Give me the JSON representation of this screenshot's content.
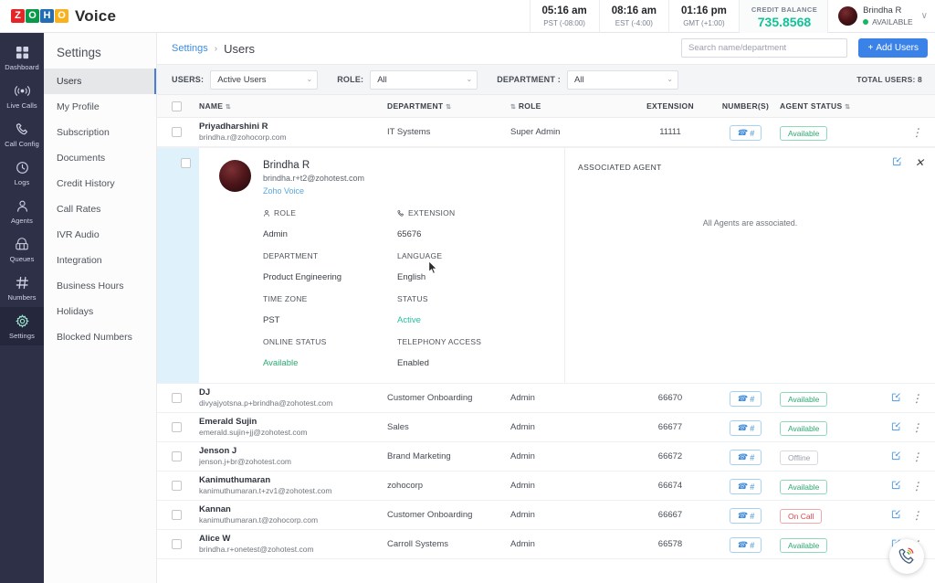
{
  "header": {
    "brand_letters": [
      "Z",
      "O",
      "H",
      "O"
    ],
    "brand_name": "Voice",
    "timezones": [
      {
        "time": "05:16 am",
        "zone": "PST (-08:00)"
      },
      {
        "time": "08:16 am",
        "zone": "EST (-4:00)"
      },
      {
        "time": "01:16 pm",
        "zone": "GMT (+1:00)"
      }
    ],
    "credit_label": "CREDIT BALANCE",
    "credit_value": "735.8568",
    "user_name": "Brindha R",
    "user_status": "AVAILABLE",
    "chevron": "∨"
  },
  "leftnav": {
    "items": [
      {
        "label": "Dashboard",
        "icon": "grid-icon"
      },
      {
        "label": "Live Calls",
        "icon": "broadcast-icon"
      },
      {
        "label": "Call Config",
        "icon": "phone-icon"
      },
      {
        "label": "Logs",
        "icon": "clock-icon"
      },
      {
        "label": "Agents",
        "icon": "person-icon"
      },
      {
        "label": "Queues",
        "icon": "queue-icon"
      },
      {
        "label": "Numbers",
        "icon": "hash-icon"
      },
      {
        "label": "Settings",
        "icon": "gear-icon"
      }
    ],
    "active": "Settings"
  },
  "subnav": {
    "title": "Settings",
    "items": [
      "Users",
      "My Profile",
      "Subscription",
      "Documents",
      "Credit History",
      "Call Rates",
      "IVR Audio",
      "Integration",
      "Business Hours",
      "Holidays",
      "Blocked Numbers"
    ],
    "active": "Users"
  },
  "breadcrumb": {
    "parent": "Settings",
    "separator": "›",
    "current": "Users"
  },
  "search": {
    "placeholder": "Search name/department",
    "value": ""
  },
  "add_button": {
    "plus": "+",
    "label": "Add Users"
  },
  "filters": {
    "users_label": "USERS:",
    "users_value": "Active Users",
    "role_label": "ROLE:",
    "role_value": "All",
    "dept_label": "DEPARTMENT :",
    "dept_value": "All",
    "caret": "⌄",
    "total_users": "TOTAL USERS: 8"
  },
  "table": {
    "columns": {
      "name": "NAME",
      "department": "DEPARTMENT",
      "role": "ROLE",
      "extension": "EXTENSION",
      "numbers": "NUMBER(S)",
      "agent_status": "AGENT STATUS"
    },
    "sort_icon": "⇅",
    "role_sort_prefix": "⇅",
    "rows": [
      {
        "name": "Priyadharshini R",
        "email": "brindha.r@zohocorp.com",
        "department": "IT Systems",
        "role": "Super Admin",
        "extension": "11111",
        "status": "Available",
        "status_kind": "available",
        "has_edit": false
      },
      {
        "name": "DJ",
        "email": "divyajyotsna.p+brindha@zohotest.com",
        "department": "Customer Onboarding",
        "role": "Admin",
        "extension": "66670",
        "status": "Available",
        "status_kind": "available",
        "has_edit": true
      },
      {
        "name": "Emerald Sujin",
        "email": "emerald.sujin+jj@zohotest.com",
        "department": "Sales",
        "role": "Admin",
        "extension": "66677",
        "status": "Available",
        "status_kind": "available",
        "has_edit": true
      },
      {
        "name": "Jenson J",
        "email": "jenson.j+br@zohotest.com",
        "department": "Brand Marketing",
        "role": "Admin",
        "extension": "66672",
        "status": "Offline",
        "status_kind": "offline",
        "has_edit": true
      },
      {
        "name": "Kanimuthumaran",
        "email": "kanimuthumaran.t+zv1@zohotest.com",
        "department": "zohocorp",
        "role": "Admin",
        "extension": "66674",
        "status": "Available",
        "status_kind": "available",
        "has_edit": true
      },
      {
        "name": "Kannan",
        "email": "kanimuthumaran.t@zohocorp.com",
        "department": "Customer Onboarding",
        "role": "Admin",
        "extension": "66667",
        "status": "On Call",
        "status_kind": "oncall",
        "has_edit": true
      },
      {
        "name": "Alice W",
        "email": "brindha.r+onetest@zohotest.com",
        "department": "Carroll Systems",
        "role": "Admin",
        "extension": "66578",
        "status": "Available",
        "status_kind": "available",
        "has_edit": true
      }
    ],
    "number_button": {
      "phone": "☎",
      "hash": "#"
    },
    "more_icon": "⋮"
  },
  "expanded": {
    "name": "Brindha R",
    "email": "brindha.r+t2@zohotest.com",
    "app_link": "Zoho Voice",
    "fields": [
      {
        "label": "ROLE",
        "value": "Admin",
        "icon": "person-icon",
        "tone": ""
      },
      {
        "label": "EXTENSION",
        "value": "65676",
        "icon": "phone-icon",
        "tone": ""
      },
      {
        "label": "DEPARTMENT",
        "value": "Product Engineering",
        "icon": "",
        "tone": ""
      },
      {
        "label": "LANGUAGE",
        "value": "English",
        "icon": "",
        "tone": ""
      },
      {
        "label": "TIME ZONE",
        "value": "PST",
        "icon": "",
        "tone": ""
      },
      {
        "label": "STATUS",
        "value": "Active",
        "icon": "",
        "tone": "teal"
      },
      {
        "label": "ONLINE STATUS",
        "value": "Available",
        "icon": "",
        "tone": "green"
      },
      {
        "label": "TELEPHONY ACCESS",
        "value": "Enabled",
        "icon": "",
        "tone": ""
      }
    ],
    "right_title": "ASSOCIATED AGENT",
    "right_empty": "All Agents are associated.",
    "close_icon": "✕"
  },
  "fab": {
    "icon": "phone-ring-icon"
  },
  "colors": {
    "accent_blue": "#3b82e8",
    "link_blue": "#3f8ddc",
    "nav_bg": "#2e3048",
    "credit_green": "#13c296",
    "status_available": "#2aa870",
    "status_oncall": "#e2474a",
    "status_offline": "#9aa0ab",
    "expanded_highlight": "#dff1fb"
  }
}
